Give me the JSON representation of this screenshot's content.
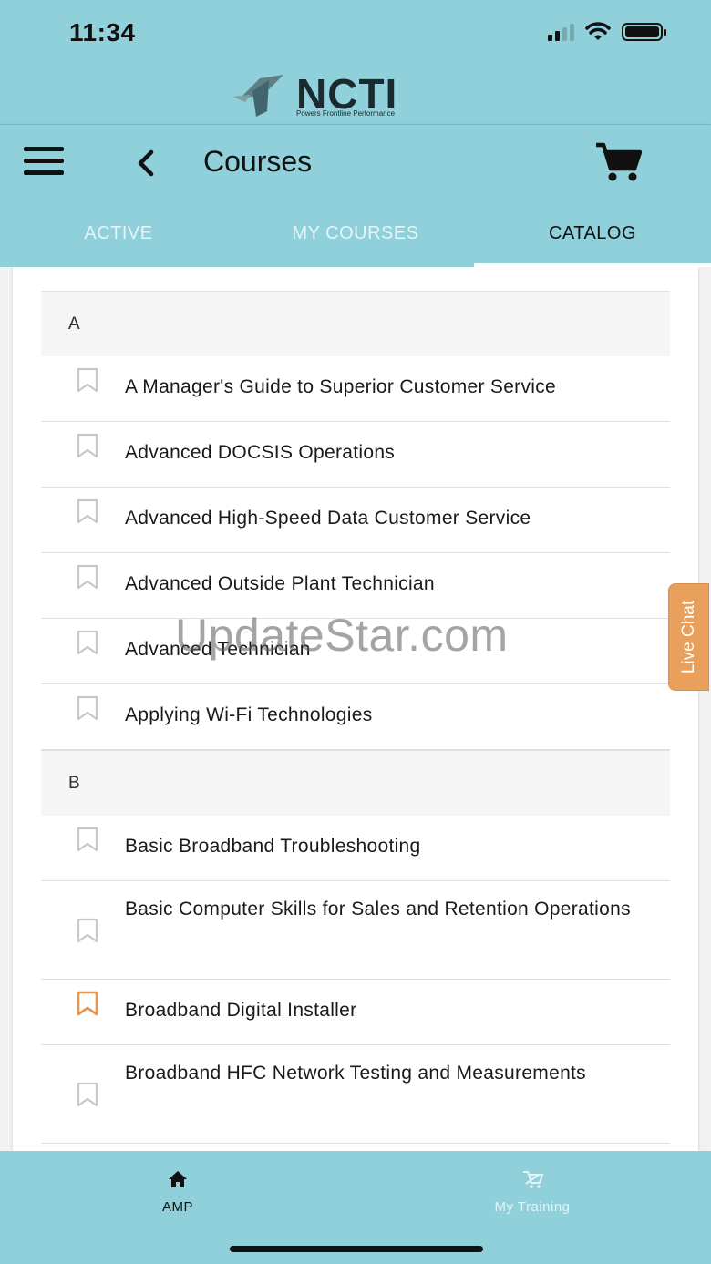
{
  "status_bar": {
    "time": "11:34"
  },
  "brand": {
    "name": "NCTI",
    "tagline": "Powers Frontline Performance"
  },
  "header": {
    "title": "Courses"
  },
  "tabs": [
    {
      "label": "ACTIVE",
      "active": false
    },
    {
      "label": "MY COURSES",
      "active": false
    },
    {
      "label": "CATALOG",
      "active": true
    }
  ],
  "catalog": {
    "sections": [
      {
        "letter": "A",
        "courses": [
          {
            "title": "A Manager's Guide to Superior Customer Service",
            "bookmarked": false
          },
          {
            "title": "Advanced DOCSIS Operations",
            "bookmarked": false
          },
          {
            "title": "Advanced High-Speed Data Customer Service",
            "bookmarked": false
          },
          {
            "title": "Advanced Outside Plant Technician",
            "bookmarked": false
          },
          {
            "title": "Advanced Technician",
            "bookmarked": false
          },
          {
            "title": "Applying Wi-Fi Technologies",
            "bookmarked": false
          }
        ]
      },
      {
        "letter": "B",
        "courses": [
          {
            "title": "Basic Broadband Troubleshooting",
            "bookmarked": false
          },
          {
            "title": "Basic Computer Skills for Sales and Retention Operations",
            "bookmarked": false
          },
          {
            "title": "Broadband Digital Installer",
            "bookmarked": true
          },
          {
            "title": "Broadband HFC Network Testing and Measurements",
            "bookmarked": false
          }
        ]
      }
    ]
  },
  "watermark": "UpdateStar.com",
  "live_chat": {
    "label": "Live Chat"
  },
  "bottom_nav": [
    {
      "label": "AMP",
      "icon": "home-icon",
      "active": true
    },
    {
      "label": "My Training",
      "icon": "training-icon",
      "active": false
    }
  ],
  "colors": {
    "header_bg": "#8fd0db",
    "bookmark_active": "#e8934a",
    "bookmark_inactive": "#c8c8c8",
    "live_chat_bg": "#e8a05c"
  }
}
